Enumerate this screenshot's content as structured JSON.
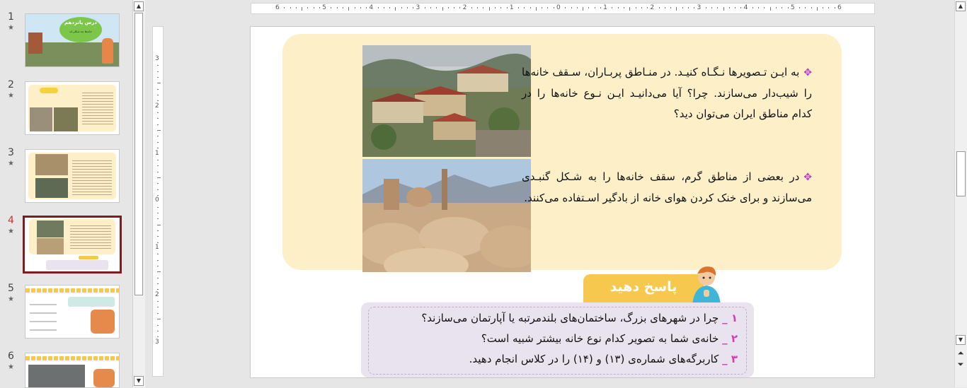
{
  "thumbnails": [
    {
      "number": "1",
      "star": "★",
      "title": "درس پانزدهم",
      "subtitle": "خانه‌ها چه شکلی‌اند",
      "active": false
    },
    {
      "number": "2",
      "star": "★",
      "active": false
    },
    {
      "number": "3",
      "star": "★",
      "active": false
    },
    {
      "number": "4",
      "star": "★",
      "active": true
    },
    {
      "number": "5",
      "star": "★",
      "active": false
    },
    {
      "number": "6",
      "star": "★",
      "active": false
    }
  ],
  "hruler": [
    "6",
    "5",
    "4",
    "3",
    "2",
    "1",
    "0",
    "1",
    "2",
    "3",
    "4",
    "5",
    "6"
  ],
  "vruler": [
    "3",
    "2",
    "1",
    "0",
    "1",
    "2",
    "3"
  ],
  "slide": {
    "bullet_icon": "✥",
    "para1": "به ایـن تـصویرها نـگـاه کنیـد. در منـاطق پربـاران، سـقف خانه‌ها را شیب‌دار می‌سازند. چرا؟ آیا می‌دانیـد ایـن نـوع خانه‌ها را در کدام مناطق ایران می‌توان دید؟",
    "para2": "در بعضی از مناطق گرم، سقف خانه‌ها را به شـکل گنبـدی می‌سازند و برای خنک کردن هوای خانه از بادگیر اسـتفاده می‌کنند.",
    "answer_label": "پاسخ دهید",
    "questions": [
      {
        "num": "۱ _",
        "text": "چرا در شهرهای بزرگ، ساختمان‌های بلندمرتبه یا آپارتمان می‌سازند؟"
      },
      {
        "num": "۲ _",
        "text": "خانه‌ی شما به تصویر کدام نوع خانه بیشتر شبیه است؟"
      },
      {
        "num": "۳ _",
        "text": "کاربرگه‌های شماره‌ی (۱۳) و (۱۴) را در کلاس انجام دهید."
      }
    ]
  },
  "scrollbar_icons": {
    "up": "▲",
    "down": "▼",
    "prev_slide": "⏶",
    "next_slide": "⏷"
  },
  "colors": {
    "info_box": "#fdf0c8",
    "answer_tab": "#f6c94e",
    "question_box": "#e9e2ef",
    "active_border": "#7a1e1e",
    "bullet": "#c039c8"
  }
}
